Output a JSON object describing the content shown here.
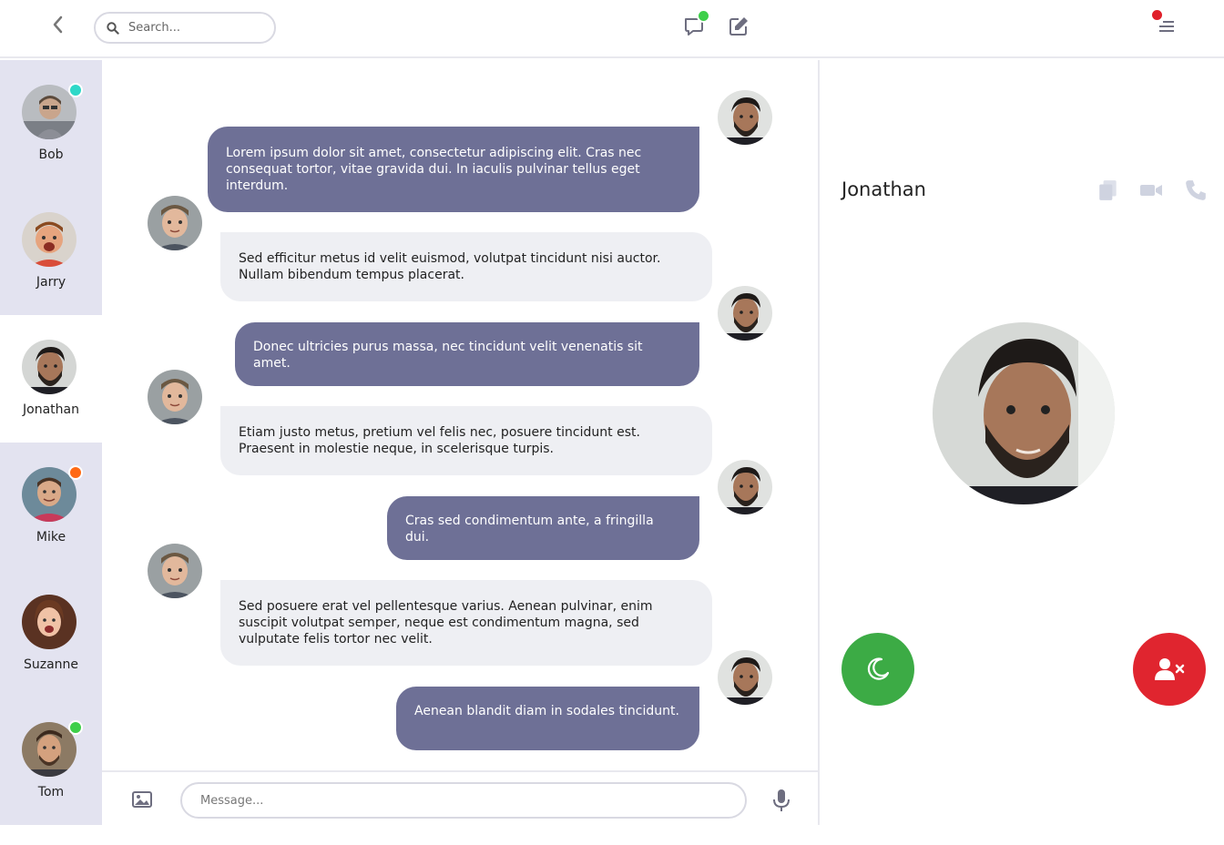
{
  "topbar": {
    "search_placeholder": "Search...",
    "icons": [
      "back-arrow-icon",
      "search-icon",
      "chat-bubble-icon",
      "edit-icon",
      "menu-icon"
    ],
    "colors": {
      "chat_badge": "#3ecf4a",
      "menu_badge": "#e0202a"
    }
  },
  "sidebar": {
    "contacts": [
      {
        "name": "Bob",
        "status": "teal"
      },
      {
        "name": "Jarry",
        "status": "none"
      },
      {
        "name": "Jonathan",
        "status": "none",
        "active": true
      },
      {
        "name": "Mike",
        "status": "orange"
      },
      {
        "name": "Suzanne",
        "status": "none"
      },
      {
        "name": "Tom",
        "status": "green"
      }
    ],
    "status_colors": {
      "teal": "#2ed8c8",
      "orange": "#ff6a14",
      "green": "#3ecf4a"
    }
  },
  "chat": {
    "messages": [
      {
        "direction": "out",
        "text": "Lorem ipsum dolor sit amet, consectetur adipiscing elit. Cras nec consequat tortor, vitae gravida dui. In iaculis pulvinar tellus eget interdum."
      },
      {
        "direction": "in",
        "text": "Sed efficitur metus id velit euismod, volutpat tincidunt nisi auctor. Nullam bibendum tempus placerat."
      },
      {
        "direction": "out",
        "text": "Donec ultricies purus massa, nec tincidunt velit venenatis sit amet."
      },
      {
        "direction": "in",
        "text": "Etiam justo metus, pretium vel felis nec, posuere tincidunt est. Praesent in molestie neque, in scelerisque turpis."
      },
      {
        "direction": "out",
        "text": "Cras sed condimentum ante, a fringilla dui."
      },
      {
        "direction": "in",
        "text": "Sed posuere erat vel pellentesque varius. Aenean pulvinar, enim suscipit volutpat semper, neque est condimentum magna, sed vulputate felis tortor nec velit."
      },
      {
        "direction": "out",
        "text": "Aenean blandit diam in sodales tincidunt."
      }
    ],
    "colors": {
      "outgoing_bubble": "#6e7096",
      "incoming_bubble": "#eeeff3"
    }
  },
  "composer": {
    "message_placeholder": "Message...",
    "icons": [
      "image-icon",
      "microphone-icon"
    ]
  },
  "panel": {
    "contact_name": "Jonathan",
    "icons": [
      "copy-icon",
      "video-camera-icon",
      "phone-icon",
      "moon-icon",
      "remove-user-icon"
    ],
    "colors": {
      "moon_button": "#3cab45",
      "remove_button": "#e0252f"
    }
  }
}
